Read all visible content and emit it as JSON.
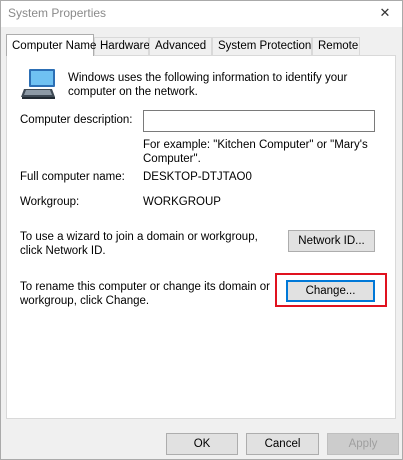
{
  "window": {
    "title": "System Properties",
    "close_symbol": "✕"
  },
  "tabs": [
    {
      "label": "Computer Name",
      "active": true
    },
    {
      "label": "Hardware",
      "active": false
    },
    {
      "label": "Advanced",
      "active": false
    },
    {
      "label": "System Protection",
      "active": false
    },
    {
      "label": "Remote",
      "active": false
    }
  ],
  "computer_name_tab": {
    "icon": "computer-icon",
    "intro_text": "Windows uses the following information to identify your computer on the network.",
    "description": {
      "label": "Computer description:",
      "value": "",
      "hint": "For example: \"Kitchen Computer\" or \"Mary's Computer\"."
    },
    "full_name": {
      "label": "Full computer name:",
      "value": "DESKTOP-DTJTAO0"
    },
    "workgroup": {
      "label": "Workgroup:",
      "value": "WORKGROUP"
    },
    "network_id": {
      "text": "To use a wizard to join a domain or workgroup, click Network ID.",
      "button_label": "Network ID..."
    },
    "change": {
      "text": "To rename this computer or change its domain or workgroup, click Change.",
      "button_label": "Change...",
      "highlight_color": "#e0121f"
    }
  },
  "footer": {
    "ok_label": "OK",
    "cancel_label": "Cancel",
    "apply_label": "Apply",
    "apply_disabled": true
  },
  "colors": {
    "focus_border": "#0078d7",
    "button_bg": "#e1e1e1",
    "dialog_bg": "#f0f0f0"
  }
}
